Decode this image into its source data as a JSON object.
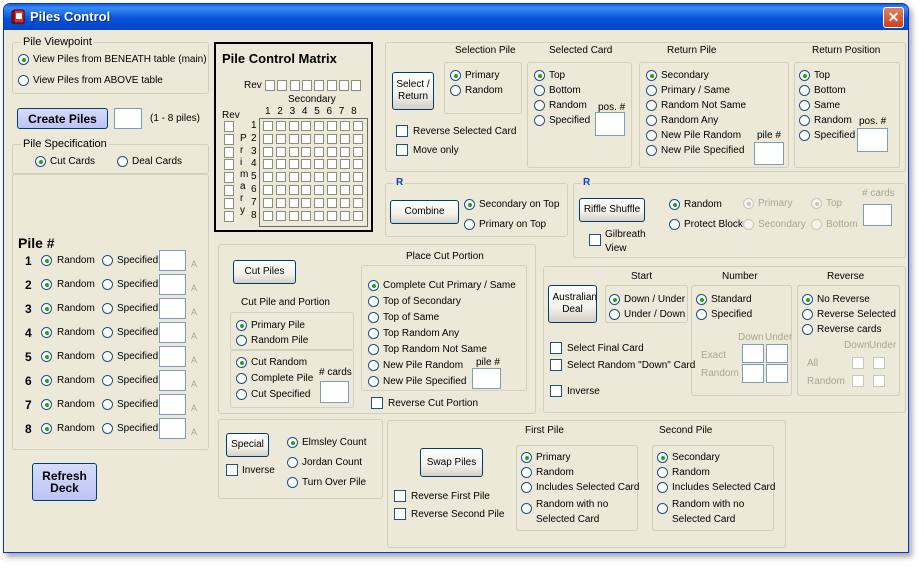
{
  "window": {
    "title": "Piles Control",
    "close": "✕"
  },
  "viewpoint": {
    "legend": "Pile Viewpoint",
    "beneath": "View Piles from BENEATH table (main)",
    "above": "View Piles from ABOVE table"
  },
  "create": {
    "button": "Create Piles",
    "value": "",
    "range": "(1 - 8 piles)"
  },
  "spec": {
    "legend": "Pile Specification",
    "cut": "Cut Cards",
    "deal": "Deal Cards"
  },
  "piles": {
    "header": "Pile #",
    "rows": [
      {
        "n": "1",
        "random": "Random",
        "specified": "Specified",
        "suffix": "A"
      },
      {
        "n": "2",
        "random": "Random",
        "specified": "Specified",
        "suffix": "A"
      },
      {
        "n": "3",
        "random": "Random",
        "specified": "Specified",
        "suffix": "A"
      },
      {
        "n": "4",
        "random": "Random",
        "specified": "Specified",
        "suffix": "A"
      },
      {
        "n": "5",
        "random": "Random",
        "specified": "Specified",
        "suffix": "A"
      },
      {
        "n": "6",
        "random": "Random",
        "specified": "Specified",
        "suffix": "A"
      },
      {
        "n": "7",
        "random": "Random",
        "specified": "Specified",
        "suffix": "A"
      },
      {
        "n": "8",
        "random": "Random",
        "specified": "Specified",
        "suffix": "A"
      }
    ]
  },
  "refresh": {
    "line1": "Refresh",
    "line2": "Deck"
  },
  "matrix": {
    "title": "Pile Control Matrix",
    "rev_top": "Rev",
    "secondary": "Secondary",
    "rev_side": "Rev",
    "primary_letters": [
      "P",
      "r",
      "i",
      "m",
      "a",
      "r",
      "y"
    ],
    "cols": [
      "1",
      "2",
      "3",
      "4",
      "5",
      "6",
      "7",
      "8"
    ],
    "rows": [
      "1",
      "2",
      "3",
      "4",
      "5",
      "6",
      "7",
      "8"
    ]
  },
  "select_return": {
    "selection_pile_label": "Selection Pile",
    "selected_card_label": "Selected Card",
    "return_pile_label": "Return Pile",
    "return_position_label": "Return Position",
    "button": "Select / Return",
    "selection_pile": [
      "Primary",
      "Random"
    ],
    "reverse_selected": "Reverse Selected Card",
    "move_only": "Move only",
    "selected_card": [
      "Top",
      "Bottom",
      "Random",
      "Specified"
    ],
    "pos_label": "pos. #",
    "return_pile": [
      "Secondary",
      "Primary / Same",
      "Random Not Same",
      "Random Any",
      "New Pile Random",
      "New Pile Specified"
    ],
    "pile_label": "pile #",
    "return_position": [
      "Top",
      "Bottom",
      "Same",
      "Random",
      "Specified"
    ]
  },
  "combine": {
    "legend": "R",
    "button": "Combine",
    "opt1": "Secondary on Top",
    "opt2": "Primary on Top"
  },
  "riffle": {
    "legend": "R",
    "button": "Riffle Shuffle",
    "random": "Random",
    "protect": "Protect Block",
    "primary": "Primary",
    "secondary": "Secondary",
    "top": "Top",
    "bottom": "Bottom",
    "cards_label": "# cards",
    "gilbreath": "Gilbreath View"
  },
  "cut": {
    "button": "Cut Piles",
    "section": "Cut Pile and Portion",
    "pile_opts": [
      "Primary Pile",
      "Random Pile"
    ],
    "portion_opts": [
      "Cut Random",
      "Complete Pile",
      "Cut Specified"
    ],
    "cards_label": "# cards",
    "place_label": "Place Cut Portion",
    "place_opts": [
      "Complete Cut Primary / Same",
      "Top of Secondary",
      "Top of Same",
      "Top Random Any",
      "Top Random Not Same",
      "New Pile Random",
      "New Pile Specified"
    ],
    "pile_label": "pile #",
    "reverse": "Reverse Cut Portion"
  },
  "australian": {
    "button": "Australian Deal",
    "start_label": "Start",
    "number_label": "Number",
    "reverse_label": "Reverse",
    "start_opts": [
      "Down / Under",
      "Under / Down"
    ],
    "number_opts": [
      "Standard",
      "Specified"
    ],
    "reverse_opts": [
      "No Reverse",
      "Reverse Selected",
      "Reverse cards"
    ],
    "down": "Down",
    "under": "Under",
    "exact": "Exact",
    "random": "Random",
    "all": "All",
    "final": "Select Final Card",
    "random_down": "Select Random \"Down\" Card",
    "inverse": "Inverse"
  },
  "special": {
    "button": "Special",
    "inverse": "Inverse",
    "opts": [
      "Elmsley Count",
      "Jordan Count",
      "Turn Over Pile"
    ]
  },
  "swap": {
    "button": "Swap Piles",
    "first_label": "First Pile",
    "second_label": "Second Pile",
    "reverse_first": "Reverse First Pile",
    "reverse_second": "Reverse Second Pile",
    "first_opts": [
      "Primary",
      "Random",
      "Includes Selected Card",
      "Random with no Selected Card"
    ],
    "second_opts": [
      "Secondary",
      "Random",
      "Includes Selected Card",
      "Random with no Selected Card"
    ]
  }
}
